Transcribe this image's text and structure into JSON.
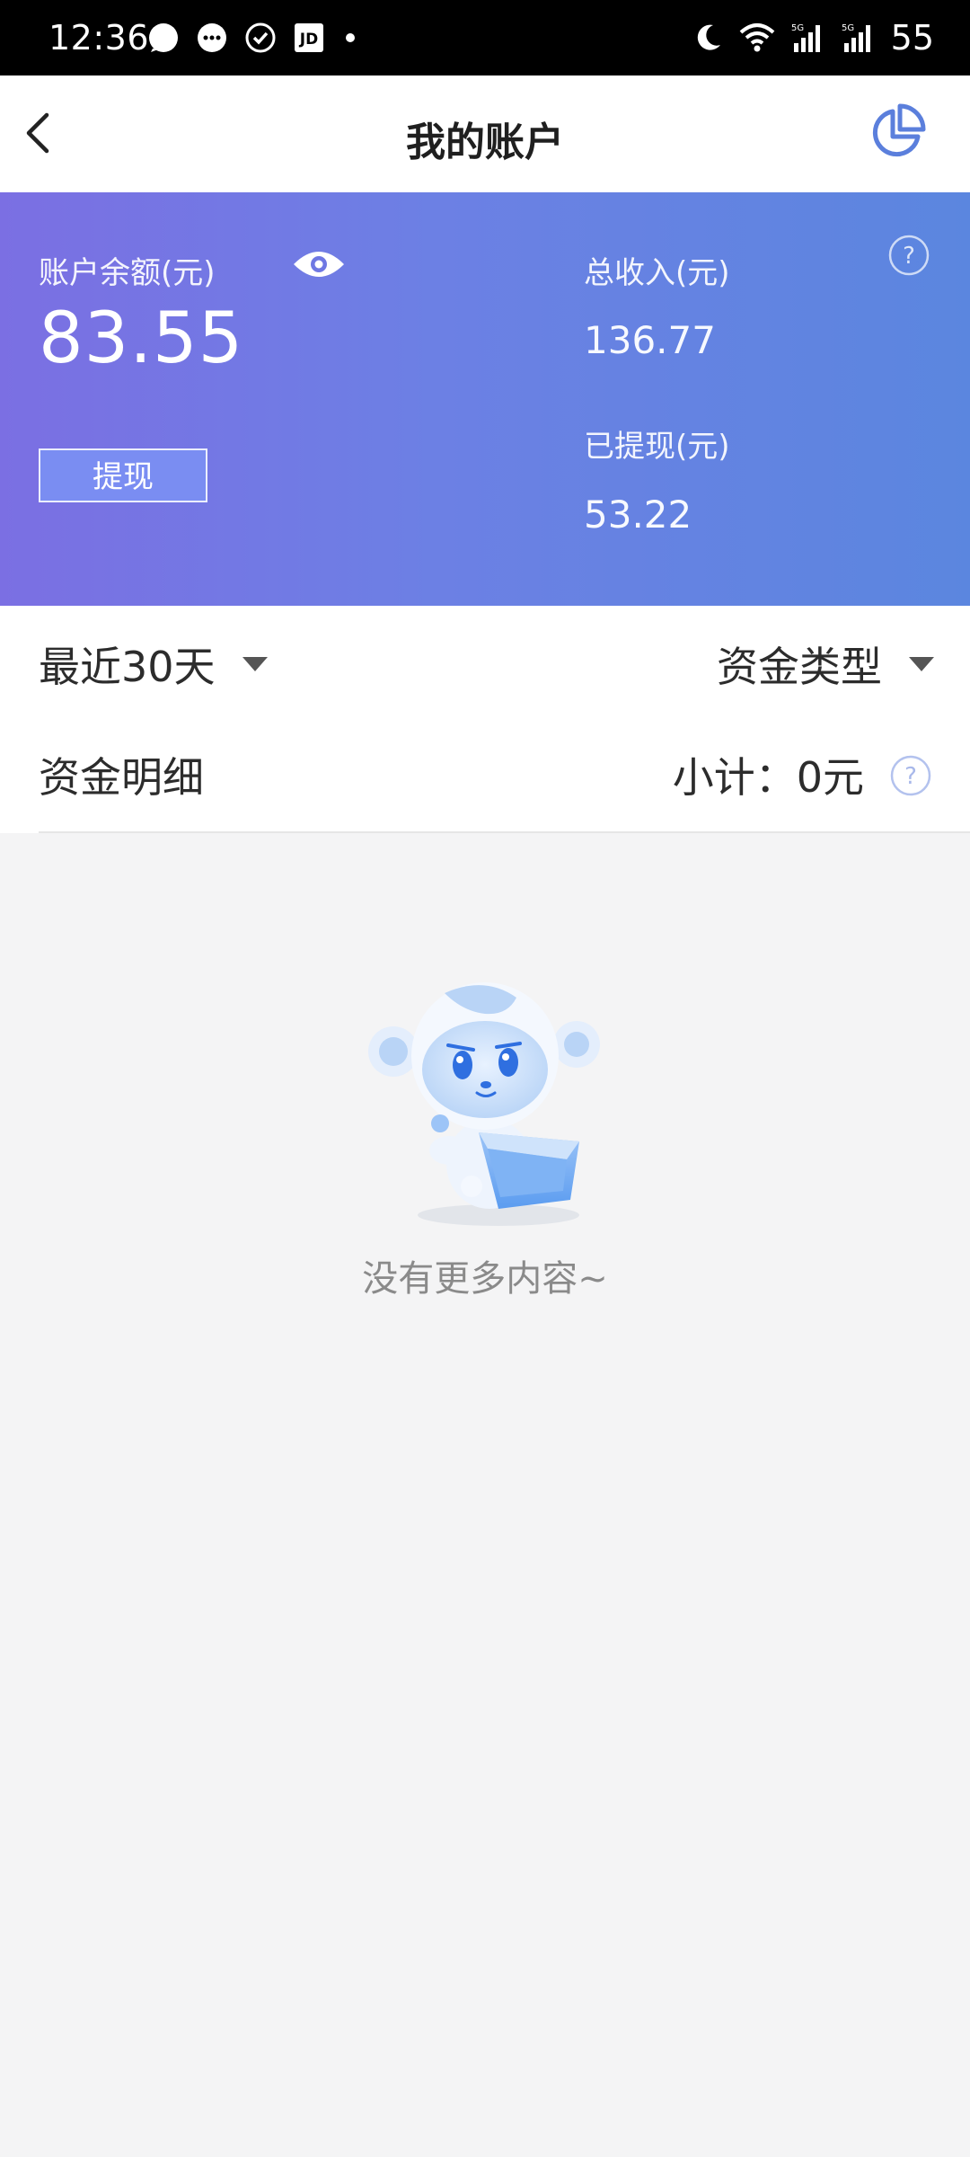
{
  "status_bar": {
    "time": "12:36",
    "battery": "55",
    "left_icons": [
      "bubble-icon",
      "chat-icon",
      "check-circle-icon",
      "jd-icon",
      "dot-icon"
    ],
    "right_icons": [
      "moon-icon",
      "wifi-icon",
      "signal-5g-icon",
      "signal-5g-icon"
    ]
  },
  "header": {
    "title": "我的账户"
  },
  "account": {
    "balance_label": "账户余额(元)",
    "balance_value": "83.55",
    "withdraw_label": "提现",
    "total_income_label": "总收入(元)",
    "total_income_value": "136.77",
    "withdrawn_label": "已提现(元)",
    "withdrawn_value": "53.22"
  },
  "filters": {
    "period": "最近30天",
    "type": "资金类型"
  },
  "details": {
    "title": "资金明细",
    "subtotal": "小计：0元"
  },
  "empty_state": {
    "text": "没有更多内容~"
  },
  "colors": {
    "banner_start": "#7b6fe3",
    "banner_end": "#5b86df",
    "accent": "#5b7fdc",
    "background": "#f4f4f5"
  }
}
